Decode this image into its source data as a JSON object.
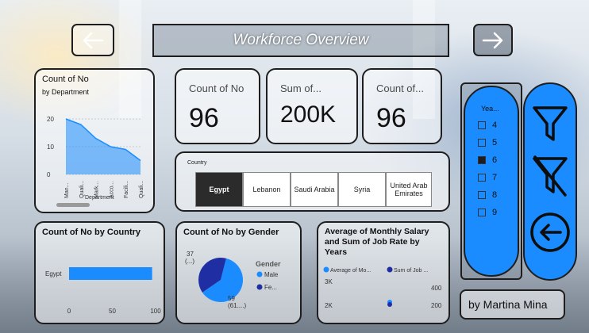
{
  "title": "Workforce Overview",
  "author": "by Martina Mina",
  "colors": {
    "accent": "#1a8cff",
    "dark": "#1e1e1e",
    "pie_dark": "#1f2fa3"
  },
  "kpis": [
    {
      "label": "Count of No",
      "value": "96"
    },
    {
      "label": "Sum of...",
      "value": "200K"
    },
    {
      "label": "Count of...",
      "value": "96"
    }
  ],
  "country_slicer": {
    "label": "Country",
    "options": [
      "Egypt",
      "Lebanon",
      "Saudi Arabia",
      "Syria",
      "United Arab Emirates"
    ],
    "selected": "Egypt"
  },
  "year_slicer": {
    "label": "Yea...",
    "options": [
      {
        "label": "4",
        "checked": false
      },
      {
        "label": "5",
        "checked": false
      },
      {
        "label": "6",
        "checked": true
      },
      {
        "label": "7",
        "checked": false
      },
      {
        "label": "8",
        "checked": false
      },
      {
        "label": "9",
        "checked": false
      }
    ]
  },
  "icons": {
    "filter": "filter-icon",
    "clear_filter": "clear-filter-icon",
    "back": "back-circle-icon",
    "prev": "arrow-left-icon",
    "next": "arrow-right-icon"
  },
  "chart_data": [
    {
      "type": "area",
      "title": "Count of No",
      "subtitle": "by Department",
      "xlabel": "Department",
      "ylabel": "",
      "categories": [
        "Man...",
        "Quali...",
        "Mark...",
        "Acco...",
        "Facili...",
        "Quali..."
      ],
      "values": [
        20,
        18,
        13,
        10,
        9,
        5
      ],
      "yticks": [
        "20",
        "10",
        "0"
      ],
      "ylim": [
        0,
        20
      ]
    },
    {
      "type": "bar",
      "title": "Count of No by Country",
      "categories": [
        "Egypt"
      ],
      "values": [
        96
      ],
      "xticks": [
        "0",
        "50",
        "100"
      ],
      "xlim": [
        0,
        100
      ]
    },
    {
      "type": "pie",
      "title": "Count of No by Gender",
      "legend_title": "Gender",
      "slices": [
        {
          "name": "Male",
          "value": 59,
          "label": "59",
          "sublabel": "(61....)"
        },
        {
          "name": "Fe...",
          "value": 37,
          "label": "37",
          "sublabel": "(...)"
        }
      ]
    },
    {
      "type": "line",
      "title": "Average of Monthly Salary and Sum of Job Rate by Years",
      "series": [
        {
          "name": "Average of Mo..."
        },
        {
          "name": "Sum of Job ..."
        }
      ],
      "y_left_ticks": [
        "3K",
        "2K"
      ],
      "y_right_ticks": [
        "400",
        "200"
      ]
    }
  ]
}
